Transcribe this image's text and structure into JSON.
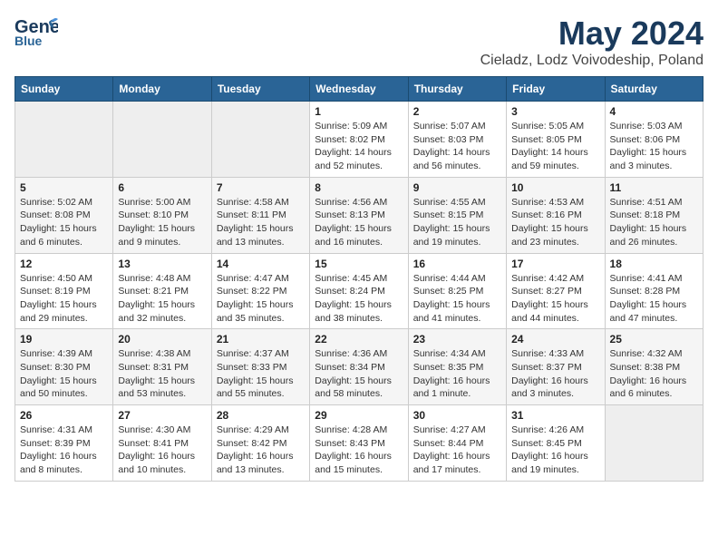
{
  "header": {
    "logo_line1": "General",
    "logo_line2": "Blue",
    "title": "May 2024",
    "subtitle": "Cieladz, Lodz Voivodeship, Poland"
  },
  "days_of_week": [
    "Sunday",
    "Monday",
    "Tuesday",
    "Wednesday",
    "Thursday",
    "Friday",
    "Saturday"
  ],
  "weeks": [
    [
      {
        "day": "",
        "info": ""
      },
      {
        "day": "",
        "info": ""
      },
      {
        "day": "",
        "info": ""
      },
      {
        "day": "1",
        "info": "Sunrise: 5:09 AM\nSunset: 8:02 PM\nDaylight: 14 hours and 52 minutes."
      },
      {
        "day": "2",
        "info": "Sunrise: 5:07 AM\nSunset: 8:03 PM\nDaylight: 14 hours and 56 minutes."
      },
      {
        "day": "3",
        "info": "Sunrise: 5:05 AM\nSunset: 8:05 PM\nDaylight: 14 hours and 59 minutes."
      },
      {
        "day": "4",
        "info": "Sunrise: 5:03 AM\nSunset: 8:06 PM\nDaylight: 15 hours and 3 minutes."
      }
    ],
    [
      {
        "day": "5",
        "info": "Sunrise: 5:02 AM\nSunset: 8:08 PM\nDaylight: 15 hours and 6 minutes."
      },
      {
        "day": "6",
        "info": "Sunrise: 5:00 AM\nSunset: 8:10 PM\nDaylight: 15 hours and 9 minutes."
      },
      {
        "day": "7",
        "info": "Sunrise: 4:58 AM\nSunset: 8:11 PM\nDaylight: 15 hours and 13 minutes."
      },
      {
        "day": "8",
        "info": "Sunrise: 4:56 AM\nSunset: 8:13 PM\nDaylight: 15 hours and 16 minutes."
      },
      {
        "day": "9",
        "info": "Sunrise: 4:55 AM\nSunset: 8:15 PM\nDaylight: 15 hours and 19 minutes."
      },
      {
        "day": "10",
        "info": "Sunrise: 4:53 AM\nSunset: 8:16 PM\nDaylight: 15 hours and 23 minutes."
      },
      {
        "day": "11",
        "info": "Sunrise: 4:51 AM\nSunset: 8:18 PM\nDaylight: 15 hours and 26 minutes."
      }
    ],
    [
      {
        "day": "12",
        "info": "Sunrise: 4:50 AM\nSunset: 8:19 PM\nDaylight: 15 hours and 29 minutes."
      },
      {
        "day": "13",
        "info": "Sunrise: 4:48 AM\nSunset: 8:21 PM\nDaylight: 15 hours and 32 minutes."
      },
      {
        "day": "14",
        "info": "Sunrise: 4:47 AM\nSunset: 8:22 PM\nDaylight: 15 hours and 35 minutes."
      },
      {
        "day": "15",
        "info": "Sunrise: 4:45 AM\nSunset: 8:24 PM\nDaylight: 15 hours and 38 minutes."
      },
      {
        "day": "16",
        "info": "Sunrise: 4:44 AM\nSunset: 8:25 PM\nDaylight: 15 hours and 41 minutes."
      },
      {
        "day": "17",
        "info": "Sunrise: 4:42 AM\nSunset: 8:27 PM\nDaylight: 15 hours and 44 minutes."
      },
      {
        "day": "18",
        "info": "Sunrise: 4:41 AM\nSunset: 8:28 PM\nDaylight: 15 hours and 47 minutes."
      }
    ],
    [
      {
        "day": "19",
        "info": "Sunrise: 4:39 AM\nSunset: 8:30 PM\nDaylight: 15 hours and 50 minutes."
      },
      {
        "day": "20",
        "info": "Sunrise: 4:38 AM\nSunset: 8:31 PM\nDaylight: 15 hours and 53 minutes."
      },
      {
        "day": "21",
        "info": "Sunrise: 4:37 AM\nSunset: 8:33 PM\nDaylight: 15 hours and 55 minutes."
      },
      {
        "day": "22",
        "info": "Sunrise: 4:36 AM\nSunset: 8:34 PM\nDaylight: 15 hours and 58 minutes."
      },
      {
        "day": "23",
        "info": "Sunrise: 4:34 AM\nSunset: 8:35 PM\nDaylight: 16 hours and 1 minute."
      },
      {
        "day": "24",
        "info": "Sunrise: 4:33 AM\nSunset: 8:37 PM\nDaylight: 16 hours and 3 minutes."
      },
      {
        "day": "25",
        "info": "Sunrise: 4:32 AM\nSunset: 8:38 PM\nDaylight: 16 hours and 6 minutes."
      }
    ],
    [
      {
        "day": "26",
        "info": "Sunrise: 4:31 AM\nSunset: 8:39 PM\nDaylight: 16 hours and 8 minutes."
      },
      {
        "day": "27",
        "info": "Sunrise: 4:30 AM\nSunset: 8:41 PM\nDaylight: 16 hours and 10 minutes."
      },
      {
        "day": "28",
        "info": "Sunrise: 4:29 AM\nSunset: 8:42 PM\nDaylight: 16 hours and 13 minutes."
      },
      {
        "day": "29",
        "info": "Sunrise: 4:28 AM\nSunset: 8:43 PM\nDaylight: 16 hours and 15 minutes."
      },
      {
        "day": "30",
        "info": "Sunrise: 4:27 AM\nSunset: 8:44 PM\nDaylight: 16 hours and 17 minutes."
      },
      {
        "day": "31",
        "info": "Sunrise: 4:26 AM\nSunset: 8:45 PM\nDaylight: 16 hours and 19 minutes."
      },
      {
        "day": "",
        "info": ""
      }
    ]
  ]
}
